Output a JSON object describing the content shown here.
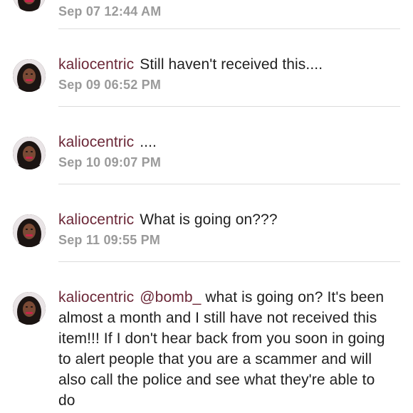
{
  "comments": [
    {
      "username": "",
      "text": "",
      "time": "Sep 07 12:44 AM"
    },
    {
      "username": "kaliocentric",
      "text": "Still haven't received this....",
      "time": "Sep 09 06:52 PM"
    },
    {
      "username": "kaliocentric",
      "text": "....",
      "time": "Sep 10 09:07 PM"
    },
    {
      "username": "kaliocentric",
      "text": "What is going on???",
      "time": "Sep 11 09:55 PM"
    },
    {
      "username": "kaliocentric",
      "mention": "@bomb_",
      "text": "what is going on? It's been almost a month and I still have not received this item!!! If I don't hear back from you soon in going to alert people that you are a scammer and will also call the police and see what they're able to do",
      "time": ""
    }
  ],
  "colors": {
    "username": "#6b2737",
    "timestamp": "#9a9a9a",
    "divider": "#dcdcdc"
  }
}
